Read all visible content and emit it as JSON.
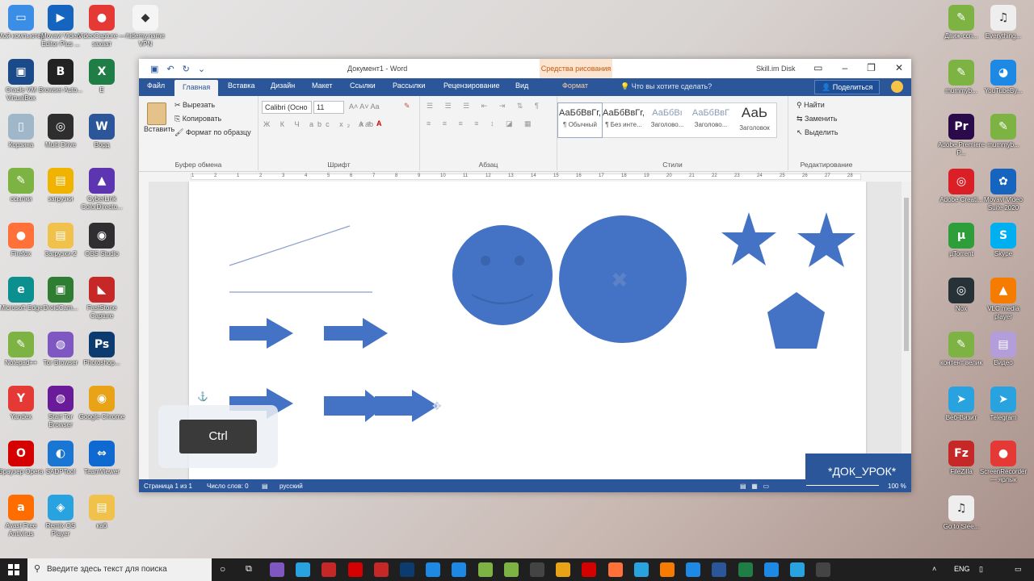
{
  "desktop_left": [
    {
      "label": "Мой компьютер",
      "color": "#3a8ee6",
      "glyph": "▭"
    },
    {
      "label": "Movavi Video Editor Plus ...",
      "color": "#1565c0",
      "glyph": "▶"
    },
    {
      "label": "VideoCapture — захват",
      "color": "#e53935",
      "glyph": "●"
    },
    {
      "label": "hidemy.name VPN",
      "color": "#f5f5f5",
      "glyph": "◆"
    },
    {
      "label": "Oracle VM VirtualBox",
      "color": "#1b4a8a",
      "glyph": "▣"
    },
    {
      "label": "Browser Auto...",
      "color": "#222222",
      "glyph": "B"
    },
    {
      "label": "E",
      "color": "#1e7e45",
      "glyph": "X"
    },
    {
      "label": "Корзина",
      "color": "#9fb7c9",
      "glyph": "▯"
    },
    {
      "label": "Multi Drive",
      "color": "#2e2e2e",
      "glyph": "◎"
    },
    {
      "label": "Ворд",
      "color": "#2b579a",
      "glyph": "W"
    },
    {
      "label": "ссылки",
      "color": "#7cb342",
      "glyph": "✎"
    },
    {
      "label": "загрузки",
      "color": "#f0b400",
      "glyph": "▤"
    },
    {
      "label": "CyberLink ColorDirecto...",
      "color": "#5e35b1",
      "glyph": "▲"
    },
    {
      "label": "Firefox",
      "color": "#ff7139",
      "glyph": "●"
    },
    {
      "label": "Загрузки-2",
      "color": "#f0c14b",
      "glyph": "▤"
    },
    {
      "label": "OBS Studio",
      "color": "#302e31",
      "glyph": "◉"
    },
    {
      "label": "Microsoft Edge",
      "color": "#0c8f8f",
      "glyph": "e"
    },
    {
      "label": "DroidCam...",
      "color": "#2e7d32",
      "glyph": "▣"
    },
    {
      "label": "FastStone Capture",
      "color": "#c62828",
      "glyph": "◣"
    },
    {
      "label": "Notepad++",
      "color": "#7cb342",
      "glyph": "✎"
    },
    {
      "label": "Tor Browser",
      "color": "#7e57c2",
      "glyph": "◍"
    },
    {
      "label": "Photoshop...",
      "color": "#0b3b6f",
      "glyph": "Ps"
    },
    {
      "label": "Yandex",
      "color": "#e53935",
      "glyph": "Y"
    },
    {
      "label": "Start Tor Browser",
      "color": "#6a1b9a",
      "glyph": "◍"
    },
    {
      "label": "Google Chrome",
      "color": "#e8a317",
      "glyph": "◉"
    },
    {
      "label": "Браузер Opera",
      "color": "#d50000",
      "glyph": "O"
    },
    {
      "label": "SADPTool",
      "color": "#1976d2",
      "glyph": "◐"
    },
    {
      "label": "TeamViewer",
      "color": "#0e6ad1",
      "glyph": "⇔"
    },
    {
      "label": "Avast Free Antivirus",
      "color": "#ff6d00",
      "glyph": "a"
    },
    {
      "label": "Remix OS Player",
      "color": "#29a3e0",
      "glyph": "◈"
    },
    {
      "label": "каб",
      "color": "#f0c14b",
      "glyph": "▤"
    }
  ],
  "desktop_right": [
    {
      "label": "Движ-ссп...",
      "color": "#7cb342",
      "glyph": "✎"
    },
    {
      "label": "Everything...",
      "color": "#eeeeee",
      "glyph": "♫"
    },
    {
      "label": "mummyb...",
      "color": "#7cb342",
      "glyph": "✎"
    },
    {
      "label": "YouTubeBy...",
      "color": "#1e88e5",
      "glyph": "◕"
    },
    {
      "label": "Adobe Premiere P...",
      "color": "#2a0a4a",
      "glyph": "Pr"
    },
    {
      "label": "mummyb...",
      "color": "#7cb342",
      "glyph": "✎"
    },
    {
      "label": "Adobe Creati...",
      "color": "#da1f26",
      "glyph": "◎"
    },
    {
      "label": "Movavi Video Suite 2020",
      "color": "#1565c0",
      "glyph": "✿"
    },
    {
      "label": "µTorrent",
      "color": "#2e9e3a",
      "glyph": "µ"
    },
    {
      "label": "Skype",
      "color": "#00aff0",
      "glyph": "S"
    },
    {
      "label": "Nox",
      "color": "#263238",
      "glyph": "◎"
    },
    {
      "label": "VLC media player",
      "color": "#f57c00",
      "glyph": "▲"
    },
    {
      "label": "контент велик",
      "color": "#7cb342",
      "glyph": "✎"
    },
    {
      "label": "Видео",
      "color": "#b39ddb",
      "glyph": "▤"
    },
    {
      "label": "Веб-Визит",
      "color": "#29a3e0",
      "glyph": "➤"
    },
    {
      "label": "Telegram",
      "color": "#29a3e0",
      "glyph": "➤"
    },
    {
      "label": "FileZilla",
      "color": "#c62828",
      "glyph": "Fz"
    },
    {
      "label": "ScreenRecorder — ярлык",
      "color": "#e53935",
      "glyph": "●"
    },
    {
      "label": "Go to Slee...",
      "color": "#eeeeee",
      "glyph": "♫"
    }
  ],
  "word": {
    "title": "Документ1 - Word",
    "context_tab": "Средства рисования",
    "skill_disk": "Skill.im Disk",
    "tabs": [
      "Файл",
      "Главная",
      "Вставка",
      "Дизайн",
      "Макет",
      "Ссылки",
      "Рассылки",
      "Рецензирование",
      "Вид",
      "Формат"
    ],
    "search_placeholder": "Что вы хотите сделать?",
    "share": "Поделиться",
    "clipboard": {
      "paste": "Вставить",
      "cut": "Вырезать",
      "copy": "Копировать",
      "format_painter": "Формат по образцу",
      "group": "Буфер обмена"
    },
    "font": {
      "name": "Calibri (Осно",
      "size": "11",
      "group": "Шрифт"
    },
    "paragraph_group": "Абзац",
    "styles": [
      {
        "sample": "АаБбВвГг,",
        "name": "¶ Обычный"
      },
      {
        "sample": "АаБбВвГг,",
        "name": "¶ Без инте..."
      },
      {
        "sample": "АаБбВı",
        "name": "Заголово..."
      },
      {
        "sample": "АаБбВвГ",
        "name": "Заголово..."
      },
      {
        "sample": "АаЬ",
        "name": "Заголовок"
      }
    ],
    "styles_group": "Стили",
    "editing": {
      "find": "Найти",
      "replace": "Заменить",
      "select": "Выделить",
      "group": "Редактирование"
    },
    "ruler_marks": [
      "1",
      "2",
      "1",
      "2",
      "3",
      "4",
      "5",
      "6",
      "7",
      "8",
      "9",
      "10",
      "11",
      "12",
      "13",
      "14",
      "15",
      "16",
      "17",
      "18",
      "19",
      "20",
      "21",
      "22",
      "23",
      "24",
      "25",
      "26",
      "27",
      "28"
    ],
    "status": {
      "page": "Страница 1 из 1",
      "words": "Число слов: 0",
      "lang": "русский",
      "zoom": "100 %"
    }
  },
  "overlay": {
    "ctrl_key": "Ctrl",
    "watermark": "*ДОК_УРОК*"
  },
  "taskbar": {
    "search_placeholder": "Введите здесь текст для поиска",
    "lang": "ENG",
    "apps": [
      "#7e57c2",
      "#29a3e0",
      "#c62828",
      "#d50000",
      "#c62828",
      "#0b3b6f",
      "#1e88e5",
      "#1e88e5",
      "#7cb342",
      "#7cb342",
      "#444444",
      "#e8a317",
      "#d50000",
      "#ff7139",
      "#29a3e0",
      "#f57c00",
      "#1e88e5",
      "#2b579a",
      "#1e7e45",
      "#1e88e5",
      "#29a3e0",
      "#444444"
    ]
  },
  "colors": {
    "word_blue": "#2b579a",
    "shape_blue": "#4472c4"
  }
}
